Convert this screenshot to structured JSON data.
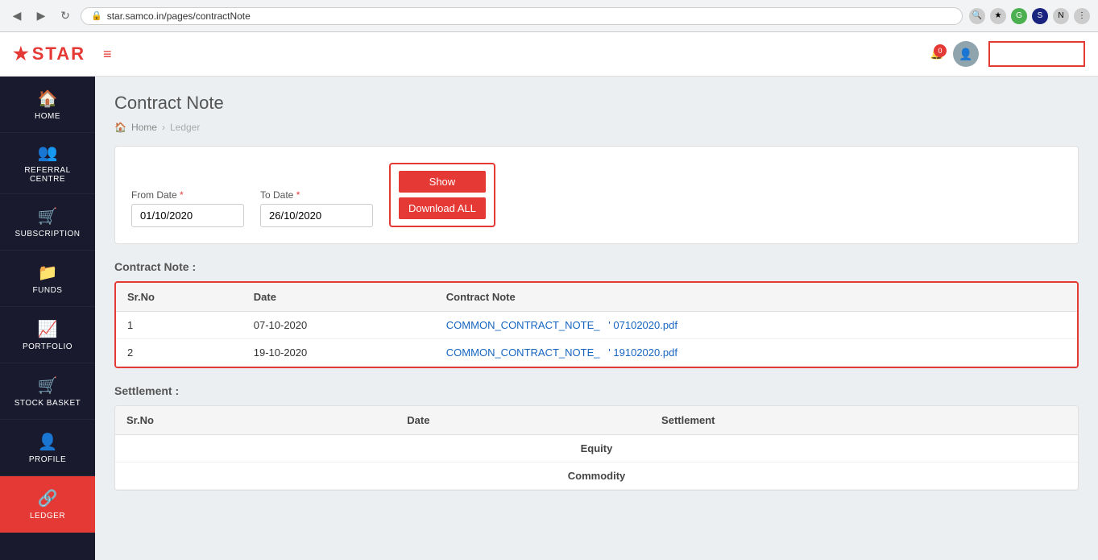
{
  "browser": {
    "url": "star.samco.in/pages/contractNote",
    "back_icon": "◀",
    "forward_icon": "▶",
    "reload_icon": "↻",
    "lock_icon": "🔒"
  },
  "header": {
    "logo_text": "STAR",
    "logo_star": "★",
    "hamburger": "≡",
    "notification_count": "0",
    "bell_icon": "🔔",
    "user_icon": "👤"
  },
  "sidebar": {
    "items": [
      {
        "id": "home",
        "label": "HOME",
        "icon": "🏠",
        "active": false
      },
      {
        "id": "referral",
        "label": "REFERRAL CENTRE",
        "icon": "👥",
        "active": false
      },
      {
        "id": "subscription",
        "label": "SUBSCRIPTION",
        "icon": "🛒",
        "active": false
      },
      {
        "id": "funds",
        "label": "FUNDS",
        "icon": "📁",
        "active": false
      },
      {
        "id": "portfolio",
        "label": "PORTFOLIO",
        "icon": "📈",
        "active": false
      },
      {
        "id": "stock-basket",
        "label": "STOCK BASKET",
        "icon": "🛒",
        "active": false
      },
      {
        "id": "profile",
        "label": "PROFILE",
        "icon": "👤",
        "active": false
      },
      {
        "id": "ledger",
        "label": "LEDGER",
        "icon": "🔗",
        "active": true
      }
    ]
  },
  "page": {
    "title": "Contract Note",
    "breadcrumb_home": "Home",
    "breadcrumb_arrow": "›",
    "breadcrumb_current": "Ledger"
  },
  "form": {
    "from_date_label": "From Date",
    "to_date_label": "To Date",
    "from_date_value": "01/10/2020",
    "to_date_value": "26/10/2020",
    "show_button": "Show",
    "download_button": "Download ALL"
  },
  "contract_note_section": {
    "title": "Contract Note :",
    "columns": [
      "Sr.No",
      "Date",
      "Contract Note"
    ],
    "rows": [
      {
        "srno": "1",
        "date": "07-10-2020",
        "file": "COMMON_CONTRACT_NOTE_",
        "suffix": "' 07102020.pdf"
      },
      {
        "srno": "2",
        "date": "19-10-2020",
        "file": "COMMON_CONTRACT_NOTE_",
        "suffix": "' 19102020.pdf"
      }
    ]
  },
  "settlement_section": {
    "title": "Settlement :",
    "columns": [
      "Sr.No",
      "Date",
      "Settlement"
    ],
    "equity_label": "Equity",
    "commodity_label": "Commodity"
  }
}
